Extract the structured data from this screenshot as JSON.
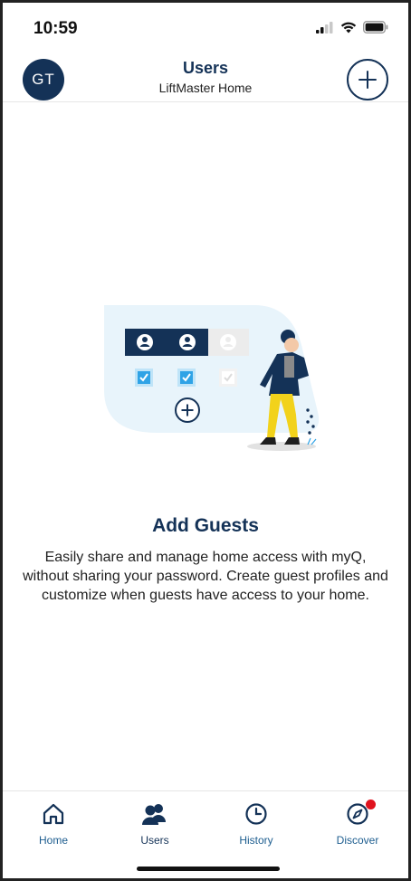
{
  "status_bar": {
    "time": "10:59"
  },
  "header": {
    "avatar_initials": "GT",
    "title": "Users",
    "subtitle": "LiftMaster Home"
  },
  "empty_state": {
    "title": "Add Guests",
    "body": "Easily share and manage home access with myQ, without sharing your password. Create guest profiles and customize when guests have access to your home."
  },
  "bottom_nav": {
    "items": [
      {
        "label": "Home",
        "icon": "home-icon",
        "active": false
      },
      {
        "label": "Users",
        "icon": "users-icon",
        "active": true
      },
      {
        "label": "History",
        "icon": "clock-icon",
        "active": false
      },
      {
        "label": "Discover",
        "icon": "compass-icon",
        "active": false,
        "badge": true
      }
    ]
  },
  "colors": {
    "primary": "#143257",
    "accent": "#1d5d8f",
    "badge": "#e0131e",
    "illustration_bg": "#e8f4fb",
    "checkbox": "#2fa3e6"
  }
}
